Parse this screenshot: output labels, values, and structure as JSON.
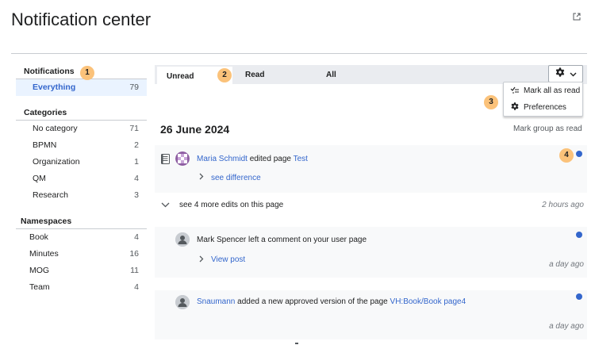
{
  "page": {
    "title": "Notification center"
  },
  "sidebar": {
    "notifications_heading": "Notifications",
    "everything": {
      "label": "Everything",
      "count": "79"
    },
    "categories_heading": "Categories",
    "categories": [
      {
        "label": "No category",
        "count": "71"
      },
      {
        "label": "BPMN",
        "count": "2"
      },
      {
        "label": "Organization",
        "count": "1"
      },
      {
        "label": "QM",
        "count": "4"
      },
      {
        "label": "Research",
        "count": "3"
      }
    ],
    "namespaces_heading": "Namespaces",
    "namespaces": [
      {
        "label": "Book",
        "count": "4"
      },
      {
        "label": "Minutes",
        "count": "16"
      },
      {
        "label": "MOG",
        "count": "11"
      },
      {
        "label": "Team",
        "count": "4"
      }
    ]
  },
  "tabs": [
    {
      "label": "Unread"
    },
    {
      "label": "Read"
    },
    {
      "label": "All"
    }
  ],
  "settings_menu": {
    "mark_all": "Mark all as read",
    "preferences": "Preferences"
  },
  "badges": [
    "1",
    "2",
    "3",
    "4"
  ],
  "group": {
    "date": "26 June 2024",
    "mark_group": "Mark group as read"
  },
  "notifications": [
    {
      "user": "Maria Schmidt",
      "action": "edited page",
      "target": "Test",
      "sub_link": "see difference",
      "more": "see 4 more edits on this page",
      "time": "2 hours ago"
    },
    {
      "user": "Mark Spencer",
      "action": "left a comment on your user page",
      "sub_link": "View post",
      "time": "a day ago"
    },
    {
      "user": "Snaumann",
      "action": "added a new approved version of the page",
      "target": "VH:Book/Book page4",
      "time": "a day ago"
    }
  ],
  "colors": {
    "accent": "#3366cc",
    "badge": "#fbc27a",
    "selected_bg": "#eaf3ff"
  }
}
